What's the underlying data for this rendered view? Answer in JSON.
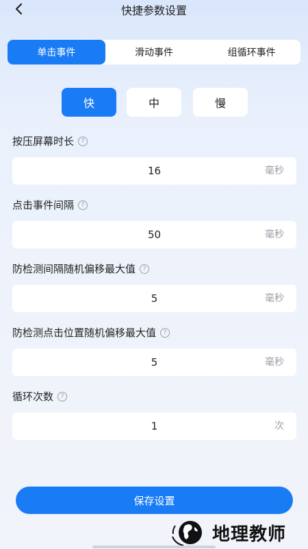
{
  "header": {
    "title": "快捷参数设置",
    "back_icon": "chevron-left-icon"
  },
  "tabs": [
    {
      "label": "单击事件",
      "active": true
    },
    {
      "label": "滑动事件",
      "active": false
    },
    {
      "label": "组循环事件",
      "active": false
    }
  ],
  "speed_options": [
    {
      "label": "快",
      "active": true
    },
    {
      "label": "中",
      "active": false
    },
    {
      "label": "慢",
      "active": false
    }
  ],
  "fields": [
    {
      "label": "按压屏幕时长",
      "value": "16",
      "unit": "毫秒"
    },
    {
      "label": "点击事件间隔",
      "value": "50",
      "unit": "毫秒"
    },
    {
      "label": "防检测间隔随机偏移最大值",
      "value": "5",
      "unit": "毫秒"
    },
    {
      "label": "防检测点击位置随机偏移最大值",
      "value": "5",
      "unit": "毫秒"
    },
    {
      "label": "循环次数",
      "value": "1",
      "unit": "次"
    }
  ],
  "help_icon_glyph": "?",
  "save_button": {
    "label": "保存设置"
  },
  "watermark": {
    "text": "地理教师"
  },
  "colors": {
    "accent": "#1a7cf5",
    "unit_text": "#9aa0a8"
  }
}
